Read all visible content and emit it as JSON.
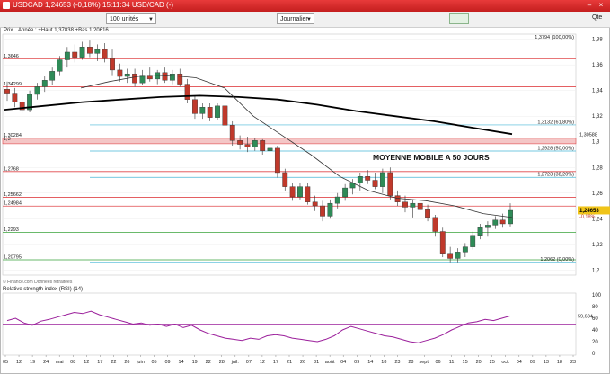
{
  "window": {
    "title": "USDCAD",
    "subtitle": "1,24653 (-0,18%) 15:11:34 USD/CAD (-)"
  },
  "toolbar": {
    "units_select": "100 unités",
    "period_select": "Journalier",
    "quote_label": "Qte"
  },
  "legend": {
    "prefix": "Prix",
    "stats": "Année : +Haut 1,37838 +Bas 1,20616"
  },
  "source_note": "© Finance.com Données retraitées",
  "rsi_label": "Relative strength index (RSI) (14)",
  "annotation": "MOYENNE MOBILE A 50 JOURS",
  "colors": {
    "up": "#2e8b57",
    "down": "#c0392b",
    "resistance": "#e0484b",
    "support": "#39a33a",
    "fibo": "#48b8d8",
    "ma50": "#333333",
    "ma200": "#000000",
    "rsi": "#9b1f9b",
    "price_badge": "#f0c419"
  },
  "chart_data": {
    "type": "candlestick",
    "y_axis_ticks": [
      "1,38",
      "1,36",
      "1,34",
      "1,32",
      "1,3",
      "1,28",
      "1,26",
      "1,24",
      "1,22",
      "1,2"
    ],
    "ylim": [
      1.196,
      1.384
    ],
    "x_ticks": [
      "05",
      "12",
      "19",
      "24",
      "mai",
      "08",
      "12",
      "17",
      "22",
      "26",
      "juin",
      "05",
      "09",
      "14",
      "19",
      "22",
      "28",
      "juil.",
      "07",
      "12",
      "17",
      "21",
      "26",
      "31",
      "août",
      "04",
      "09",
      "14",
      "18",
      "23",
      "28",
      "sept.",
      "06",
      "11",
      "15",
      "20",
      "25",
      "oct.",
      "04",
      "09",
      "13",
      "18",
      "23"
    ],
    "levels_left": [
      {
        "label": "1,3646",
        "value": 1.3646,
        "kind": "resistance"
      },
      {
        "label": "1,34299",
        "value": 1.34299,
        "kind": "resistance"
      },
      {
        "label": "1,30284",
        "value": 1.30284,
        "kind": "resistance"
      },
      {
        "label": "1,3",
        "value": 1.3,
        "kind": "zone"
      },
      {
        "label": "1,2768",
        "value": 1.2768,
        "kind": "resistance"
      },
      {
        "label": "1,25662",
        "value": 1.25662,
        "kind": "resistance"
      },
      {
        "label": "1,24984",
        "value": 1.24984,
        "kind": "resistance"
      },
      {
        "label": "1,2293",
        "value": 1.2293,
        "kind": "support"
      },
      {
        "label": "1,20795",
        "value": 1.20795,
        "kind": "support"
      }
    ],
    "fibonacci": [
      {
        "label": "1,3794 (100,00%)",
        "value": 1.3794
      },
      {
        "label": "1,3132 (61,80%)",
        "value": 1.3132
      },
      {
        "label": "1,2928 (50,00%)",
        "value": 1.2928
      },
      {
        "label": "1,2723 (38,20%)",
        "value": 1.2723
      },
      {
        "label": "1,2062 (0,00%)",
        "value": 1.2062
      }
    ],
    "right_badges": [
      {
        "label": "1,30588",
        "value": 1.30588
      },
      {
        "label": "1,24653",
        "value": 1.24653
      },
      {
        "label": "-0,18%",
        "value": 1.2418
      }
    ],
    "candles": [
      [
        1.341,
        1.347,
        1.332,
        1.338
      ],
      [
        1.338,
        1.342,
        1.327,
        1.331
      ],
      [
        1.331,
        1.336,
        1.322,
        1.325
      ],
      [
        1.325,
        1.34,
        1.323,
        1.337
      ],
      [
        1.337,
        1.346,
        1.333,
        1.343
      ],
      [
        1.343,
        1.351,
        1.339,
        1.348
      ],
      [
        1.348,
        1.358,
        1.344,
        1.355
      ],
      [
        1.355,
        1.367,
        1.352,
        1.364
      ],
      [
        1.364,
        1.374,
        1.358,
        1.37
      ],
      [
        1.37,
        1.376,
        1.362,
        1.366
      ],
      [
        1.366,
        1.378,
        1.364,
        1.374
      ],
      [
        1.374,
        1.379,
        1.366,
        1.369
      ],
      [
        1.369,
        1.376,
        1.363,
        1.372
      ],
      [
        1.372,
        1.377,
        1.362,
        1.365
      ],
      [
        1.365,
        1.372,
        1.352,
        1.356
      ],
      [
        1.356,
        1.361,
        1.347,
        1.351
      ],
      [
        1.351,
        1.357,
        1.346,
        1.353
      ],
      [
        1.353,
        1.357,
        1.343,
        1.346
      ],
      [
        1.346,
        1.356,
        1.344,
        1.352
      ],
      [
        1.352,
        1.358,
        1.347,
        1.349
      ],
      [
        1.349,
        1.356,
        1.345,
        1.354
      ],
      [
        1.354,
        1.358,
        1.346,
        1.348
      ],
      [
        1.348,
        1.356,
        1.345,
        1.353
      ],
      [
        1.353,
        1.357,
        1.343,
        1.345
      ],
      [
        1.345,
        1.349,
        1.33,
        1.333
      ],
      [
        1.333,
        1.336,
        1.318,
        1.322
      ],
      [
        1.322,
        1.33,
        1.318,
        1.327
      ],
      [
        1.327,
        1.33,
        1.316,
        1.319
      ],
      [
        1.319,
        1.33,
        1.317,
        1.328
      ],
      [
        1.328,
        1.331,
        1.311,
        1.313
      ],
      [
        1.313,
        1.316,
        1.297,
        1.301
      ],
      [
        1.301,
        1.305,
        1.294,
        1.298
      ],
      [
        1.298,
        1.304,
        1.292,
        1.296
      ],
      [
        1.296,
        1.303,
        1.293,
        1.301
      ],
      [
        1.301,
        1.302,
        1.29,
        1.293
      ],
      [
        1.293,
        1.298,
        1.289,
        1.295
      ],
      [
        1.295,
        1.297,
        1.272,
        1.276
      ],
      [
        1.276,
        1.279,
        1.262,
        1.265
      ],
      [
        1.265,
        1.268,
        1.254,
        1.257
      ],
      [
        1.257,
        1.268,
        1.255,
        1.265
      ],
      [
        1.265,
        1.268,
        1.251,
        1.253
      ],
      [
        1.253,
        1.258,
        1.246,
        1.25
      ],
      [
        1.25,
        1.254,
        1.238,
        1.242
      ],
      [
        1.242,
        1.255,
        1.24,
        1.252
      ],
      [
        1.252,
        1.26,
        1.248,
        1.257
      ],
      [
        1.257,
        1.267,
        1.254,
        1.264
      ],
      [
        1.264,
        1.271,
        1.259,
        1.268
      ],
      [
        1.268,
        1.276,
        1.262,
        1.273
      ],
      [
        1.273,
        1.278,
        1.267,
        1.27
      ],
      [
        1.27,
        1.276,
        1.263,
        1.265
      ],
      [
        1.265,
        1.279,
        1.26,
        1.276
      ],
      [
        1.276,
        1.28,
        1.255,
        1.258
      ],
      [
        1.258,
        1.262,
        1.25,
        1.253
      ],
      [
        1.253,
        1.258,
        1.245,
        1.249
      ],
      [
        1.249,
        1.255,
        1.241,
        1.252
      ],
      [
        1.252,
        1.255,
        1.243,
        1.247
      ],
      [
        1.247,
        1.251,
        1.238,
        1.241
      ],
      [
        1.241,
        1.243,
        1.226,
        1.23
      ],
      [
        1.23,
        1.233,
        1.21,
        1.213
      ],
      [
        1.213,
        1.218,
        1.206,
        1.209
      ],
      [
        1.209,
        1.217,
        1.206,
        1.214
      ],
      [
        1.214,
        1.221,
        1.21,
        1.218
      ],
      [
        1.218,
        1.23,
        1.216,
        1.227
      ],
      [
        1.227,
        1.236,
        1.224,
        1.233
      ],
      [
        1.233,
        1.238,
        1.226,
        1.235
      ],
      [
        1.235,
        1.242,
        1.232,
        1.239
      ],
      [
        1.239,
        1.244,
        1.233,
        1.236
      ],
      [
        1.236,
        1.252,
        1.234,
        1.2465
      ]
    ],
    "ma50": [
      1.342,
      1.347,
      1.351,
      1.352,
      1.35,
      1.342,
      1.32,
      1.305,
      1.29,
      1.273,
      1.262,
      1.256,
      1.254,
      1.25,
      1.244,
      1.241
    ],
    "ma200": [
      1.325,
      1.328,
      1.331,
      1.333,
      1.335,
      1.336,
      1.335,
      1.333,
      1.329,
      1.324,
      1.32,
      1.316,
      1.311,
      1.306
    ],
    "rsi": {
      "ticks": [
        "100",
        "80",
        "60",
        "40",
        "20",
        "0"
      ],
      "ylim": [
        0,
        100
      ],
      "current_label": "59,634",
      "level": 50,
      "values": [
        56,
        60,
        52,
        48,
        55,
        58,
        62,
        66,
        70,
        68,
        72,
        66,
        62,
        58,
        54,
        50,
        52,
        48,
        50,
        46,
        50,
        44,
        48,
        40,
        34,
        30,
        26,
        24,
        22,
        26,
        24,
        30,
        32,
        30,
        26,
        24,
        22,
        20,
        24,
        30,
        40,
        46,
        42,
        38,
        34,
        30,
        28,
        24,
        20,
        18,
        22,
        26,
        32,
        40,
        46,
        52,
        54,
        58,
        56,
        60,
        64
      ]
    }
  }
}
